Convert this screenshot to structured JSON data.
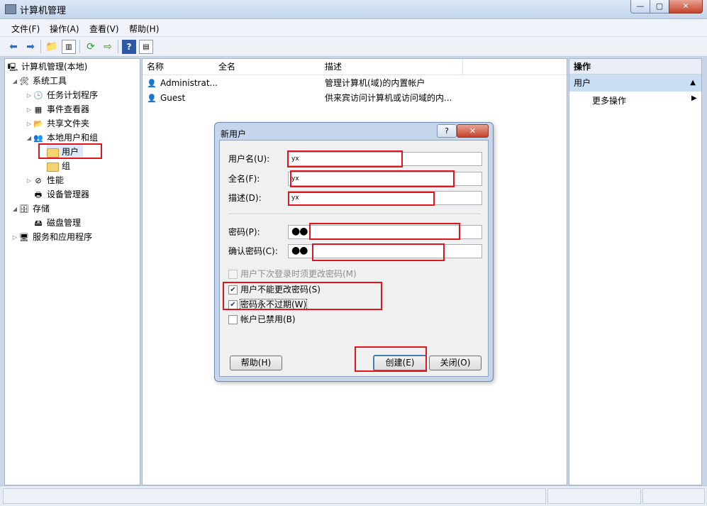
{
  "window": {
    "title": "计算机管理",
    "min": "—",
    "max": "▢",
    "close": "✕"
  },
  "menu": [
    "文件(F)",
    "操作(A)",
    "查看(V)",
    "帮助(H)"
  ],
  "tree": {
    "root": "计算机管理(本地)",
    "system_tools": "系统工具",
    "task_scheduler": "任务计划程序",
    "event_viewer": "事件查看器",
    "shared_folders": "共享文件夹",
    "local_users_groups": "本地用户和组",
    "users": "用户",
    "groups": "组",
    "performance": "性能",
    "device_manager": "设备管理器",
    "storage": "存储",
    "disk_management": "磁盘管理",
    "services_apps": "服务和应用程序"
  },
  "list": {
    "columns": [
      "名称",
      "全名",
      "描述"
    ],
    "rows": [
      {
        "name": "Administrat...",
        "full": "",
        "desc": "管理计算机(域)的内置帐户"
      },
      {
        "name": "Guest",
        "full": "",
        "desc": "供来宾访问计算机或访问域的内..."
      }
    ]
  },
  "actions": {
    "title": "操作",
    "section": "用户",
    "more": "更多操作"
  },
  "dialog": {
    "title": "新用户",
    "help_icon": "?",
    "close_icon": "✕",
    "username_label": "用户名(U):",
    "username_value": "yx",
    "fullname_label": "全名(F):",
    "fullname_value": "yx",
    "desc_label": "描述(D):",
    "desc_value": "yx",
    "password_label": "密码(P):",
    "password_value": "●●",
    "confirm_label": "确认密码(C):",
    "confirm_value": "●●",
    "cb_must_change": "用户下次登录时须更改密码(M)",
    "cb_cannot_change": "用户不能更改密码(S)",
    "cb_never_expires": "密码永不过期(W)",
    "cb_disabled": "帐户已禁用(B)",
    "checked": "✔",
    "help_button": "帮助(H)",
    "create_button": "创建(E)",
    "close_button": "关闭(O)"
  }
}
